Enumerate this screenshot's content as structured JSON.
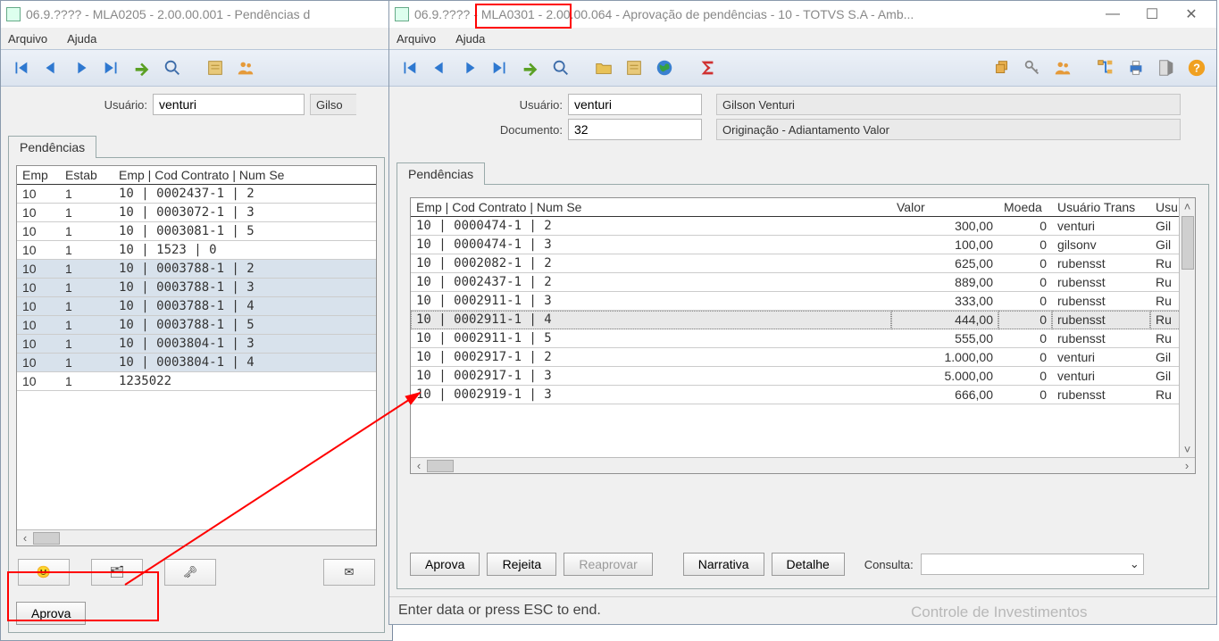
{
  "win1": {
    "title": "06.9.???? - MLA0205 - 2.00.00.001 - Pendências d",
    "menu": {
      "arquivo": "Arquivo",
      "ajuda": "Ajuda"
    },
    "form": {
      "usuario_label": "Usuário:",
      "usuario_value": "venturi",
      "usuario_desc": "Gilso"
    },
    "tab": "Pendências",
    "cols": {
      "emp": "Emp",
      "estab": "Estab",
      "chave": "Emp | Cod Contrato | Num Se"
    },
    "rows": [
      {
        "emp": "10",
        "estab": "1",
        "chave": "10  | 0002437-1              | 2",
        "sel": false
      },
      {
        "emp": "10",
        "estab": "1",
        "chave": "10  | 0003072-1              | 3",
        "sel": false
      },
      {
        "emp": "10",
        "estab": "1",
        "chave": "10  | 0003081-1              | 5",
        "sel": false
      },
      {
        "emp": "10",
        "estab": "1",
        "chave": "10  | 1523       | 0",
        "sel": false
      },
      {
        "emp": "10",
        "estab": "1",
        "chave": "10  | 0003788-1              | 2",
        "sel": true
      },
      {
        "emp": "10",
        "estab": "1",
        "chave": "10  | 0003788-1              | 3",
        "sel": true
      },
      {
        "emp": "10",
        "estab": "1",
        "chave": "10  | 0003788-1              | 4",
        "sel": true
      },
      {
        "emp": "10",
        "estab": "1",
        "chave": "10  | 0003788-1              | 5",
        "sel": true
      },
      {
        "emp": "10",
        "estab": "1",
        "chave": "10  | 0003804-1              | 3",
        "sel": true
      },
      {
        "emp": "10",
        "estab": "1",
        "chave": "10  | 0003804-1              | 4",
        "sel": true
      },
      {
        "emp": "10",
        "estab": "1",
        "chave": "1235022",
        "sel": false
      }
    ],
    "aprova": "Aprova"
  },
  "win2": {
    "title_pre": "06.9.????",
    "title_mid": "- MLA0301 -",
    "title_post": "2.00.00.064 - Aprovação de pendências - 10 - TOTVS S.A - Amb...",
    "menu": {
      "arquivo": "Arquivo",
      "ajuda": "Ajuda"
    },
    "form": {
      "usuario_label": "Usuário:",
      "usuario_value": "venturi",
      "usuario_desc": "Gilson Venturi",
      "documento_label": "Documento:",
      "documento_value": "32",
      "documento_desc": "Originação - Adiantamento Valor"
    },
    "tab": "Pendências",
    "cols": {
      "chave": "Emp | Cod Contrato | Num Se",
      "valor": "Valor",
      "moeda": "Moeda",
      "ut": "Usuário Trans",
      "usu": "Usu"
    },
    "rows": [
      {
        "chave": "10  | 0000474-1           | 2",
        "valor": "300,00",
        "moeda": "0",
        "ut": "venturi",
        "usu": "Gil",
        "sel": false
      },
      {
        "chave": "10  | 0000474-1           | 3",
        "valor": "100,00",
        "moeda": "0",
        "ut": "gilsonv",
        "usu": "Gil",
        "sel": false
      },
      {
        "chave": "10  | 0002082-1           | 2",
        "valor": "625,00",
        "moeda": "0",
        "ut": "rubensst",
        "usu": "Ru",
        "sel": false
      },
      {
        "chave": "10  | 0002437-1           | 2",
        "valor": "889,00",
        "moeda": "0",
        "ut": "rubensst",
        "usu": "Ru",
        "sel": false
      },
      {
        "chave": "10  | 0002911-1           | 3",
        "valor": "333,00",
        "moeda": "0",
        "ut": "rubensst",
        "usu": "Ru",
        "sel": false
      },
      {
        "chave": "10  | 0002911-1           | 4",
        "valor": "444,00",
        "moeda": "0",
        "ut": "rubensst",
        "usu": "Ru",
        "sel": true
      },
      {
        "chave": "10  | 0002911-1           | 5",
        "valor": "555,00",
        "moeda": "0",
        "ut": "rubensst",
        "usu": "Ru",
        "sel": false
      },
      {
        "chave": "10  | 0002917-1           | 2",
        "valor": "1.000,00",
        "moeda": "0",
        "ut": "venturi",
        "usu": "Gil",
        "sel": false
      },
      {
        "chave": "10  | 0002917-1           | 3",
        "valor": "5.000,00",
        "moeda": "0",
        "ut": "venturi",
        "usu": "Gil",
        "sel": false
      },
      {
        "chave": "10  | 0002919-1           | 3",
        "valor": "666,00",
        "moeda": "0",
        "ut": "rubensst",
        "usu": "Ru",
        "sel": false
      }
    ],
    "btns": {
      "aprova": "Aprova",
      "rejeita": "Rejeita",
      "reaprovar": "Reaprovar",
      "narrativa": "Narrativa",
      "detalhe": "Detalhe",
      "consulta": "Consulta:"
    },
    "status": "Enter data or press ESC to end.",
    "partial_below": "Controle de Investimentos"
  }
}
